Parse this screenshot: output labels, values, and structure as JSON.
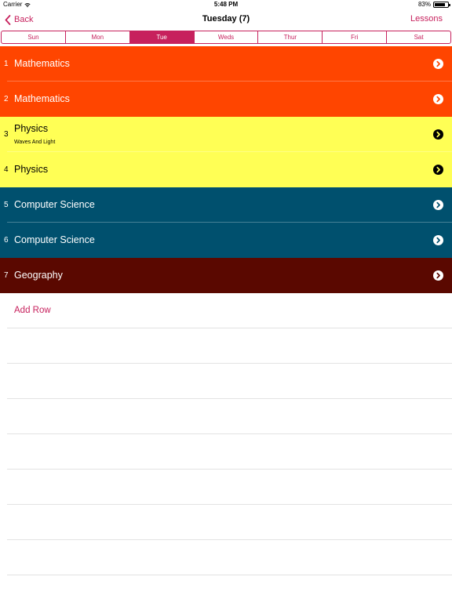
{
  "status_bar": {
    "carrier": "Carrier",
    "time": "5:48 PM",
    "battery": "83%",
    "battery_level": 0.83
  },
  "nav": {
    "back_label": "Back",
    "title": "Tuesday (7)",
    "right_label": "Lessons"
  },
  "days": [
    {
      "label": "Sun",
      "active": false
    },
    {
      "label": "Mon",
      "active": false
    },
    {
      "label": "Tue",
      "active": true
    },
    {
      "label": "Weds",
      "active": false
    },
    {
      "label": "Thur",
      "active": false
    },
    {
      "label": "Fri",
      "active": false
    },
    {
      "label": "Sat",
      "active": false
    }
  ],
  "lessons": [
    {
      "num": "1",
      "name": "Mathematics",
      "sub": "",
      "bg": "#ff4500",
      "fg": "#ffffff"
    },
    {
      "num": "2",
      "name": "Mathematics",
      "sub": "",
      "bg": "#ff4500",
      "fg": "#ffffff"
    },
    {
      "num": "3",
      "name": "Physics",
      "sub": "Waves And Light",
      "bg": "#ffff55",
      "fg": "#000000"
    },
    {
      "num": "4",
      "name": "Physics",
      "sub": "",
      "bg": "#ffff55",
      "fg": "#000000"
    },
    {
      "num": "5",
      "name": "Computer Science",
      "sub": "",
      "bg": "#00506e",
      "fg": "#ffffff"
    },
    {
      "num": "6",
      "name": "Computer Science",
      "sub": "",
      "bg": "#00506e",
      "fg": "#ffffff"
    },
    {
      "num": "7",
      "name": "Geography",
      "sub": "",
      "bg": "#5a0800",
      "fg": "#ffffff"
    }
  ],
  "add_row_label": "Add Row",
  "colors": {
    "accent": "#c7215d"
  },
  "icons": {
    "row_disclosure": "chevron-right-circle-icon",
    "back": "chevron-left-icon",
    "wifi": "wifi-icon",
    "battery": "battery-icon"
  }
}
